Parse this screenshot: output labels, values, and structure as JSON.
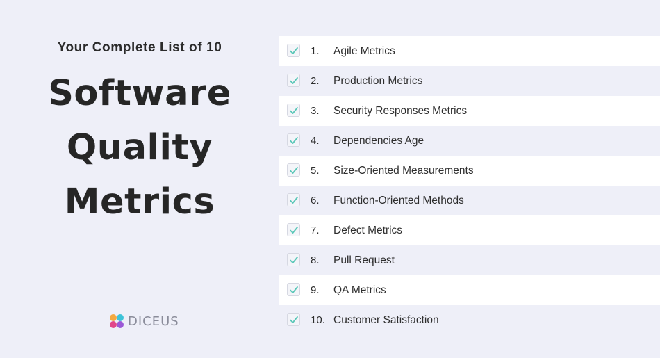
{
  "heading": {
    "subtitle": "Your Complete List of 10",
    "title_lines": [
      "Software",
      "Quality",
      "Metrics"
    ]
  },
  "brand": {
    "logo_text": "DICEUS",
    "logo_colors": [
      "#f4a940",
      "#3ec3d8",
      "#9b59d6",
      "#e0468a"
    ]
  },
  "colors": {
    "checkmark": "#5ac7b8",
    "row_white": "#ffffff",
    "row_tint": "#eeeff8"
  },
  "items": [
    {
      "num": "1.",
      "label": "Agile Metrics"
    },
    {
      "num": "2.",
      "label": "Production Metrics"
    },
    {
      "num": "3.",
      "label": "Security Responses Metrics"
    },
    {
      "num": "4.",
      "label": "Dependencies Age"
    },
    {
      "num": "5.",
      "label": "Size-Oriented Measurements"
    },
    {
      "num": "6.",
      "label": "Function-Oriented Methods"
    },
    {
      "num": "7.",
      "label": "Defect Metrics"
    },
    {
      "num": "8.",
      "label": "Pull Request"
    },
    {
      "num": "9.",
      "label": "QA Metrics"
    },
    {
      "num": "10.",
      "label": "Customer Satisfaction"
    }
  ]
}
